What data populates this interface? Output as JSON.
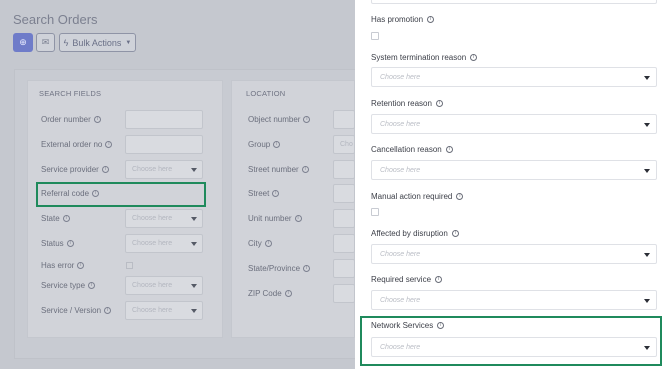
{
  "page": {
    "title": "Search Orders"
  },
  "toolbar": {
    "bulk_label": "Bulk Actions"
  },
  "search_fields": {
    "heading": "SEARCH FIELDS",
    "fields": [
      {
        "label": "Order number"
      },
      {
        "label": "External order no"
      },
      {
        "label": "Service provider",
        "placeholder": "Choose here"
      },
      {
        "label": "Referral code"
      },
      {
        "label": "State",
        "placeholder": "Choose here"
      },
      {
        "label": "Status",
        "placeholder": "Choose here"
      },
      {
        "label": "Has error"
      },
      {
        "label": "Service type",
        "placeholder": "Choose here"
      },
      {
        "label": "Service / Version",
        "placeholder": "Choose here"
      }
    ]
  },
  "location": {
    "heading": "LOCATION",
    "fields": [
      {
        "label": "Object number"
      },
      {
        "label": "Group",
        "placeholder": "Cho"
      },
      {
        "label": "Street number"
      },
      {
        "label": "Street"
      },
      {
        "label": "Unit number"
      },
      {
        "label": "City"
      },
      {
        "label": "State/Province"
      },
      {
        "label": "ZIP Code"
      }
    ]
  },
  "drawer": {
    "has_promotion": {
      "label": "Has promotion"
    },
    "system_termination": {
      "label": "System termination reason",
      "placeholder": "Choose here"
    },
    "retention": {
      "label": "Retention reason",
      "placeholder": "Choose here"
    },
    "cancellation": {
      "label": "Cancellation reason",
      "placeholder": "Choose here"
    },
    "manual_action": {
      "label": "Manual action required"
    },
    "affected": {
      "label": "Affected by disruption",
      "placeholder": "Choose here"
    },
    "required_service": {
      "label": "Required service",
      "placeholder": "Choose here"
    },
    "network_services": {
      "label": "Network Services",
      "placeholder": "Choose here"
    }
  },
  "colors": {
    "highlight": "#1f8a5c",
    "primary_button": "#6f7cc9"
  }
}
